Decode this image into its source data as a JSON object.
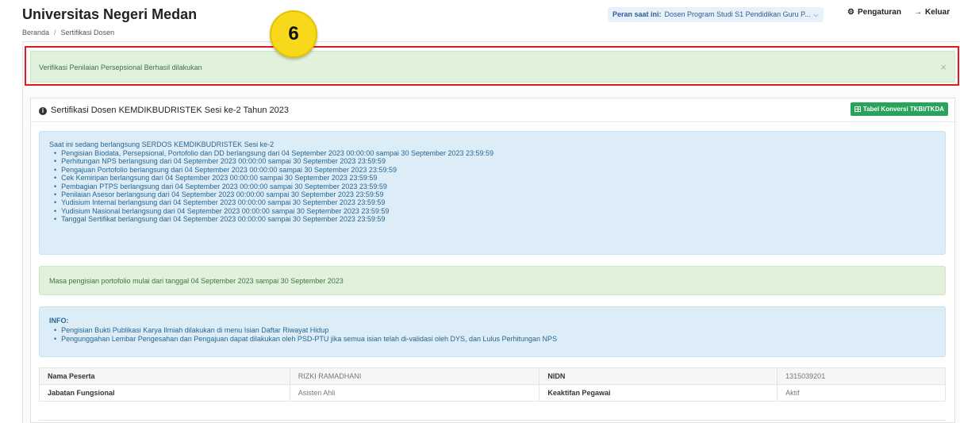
{
  "header": {
    "brand": "Universitas Negeri Medan",
    "breadcrumb": [
      "Beranda",
      "Sertifikasi Dosen"
    ],
    "role_label": "Peran saat ini:",
    "role_value": "Dosen Program Studi S1 Pendidikan Guru P...",
    "settings_label": "Pengaturan",
    "logout_label": "Keluar"
  },
  "step_badge": "6",
  "alert_success": {
    "message": "Verifikasi Penilaian Persepsional Berhasil dilakukan",
    "close": "×"
  },
  "panel": {
    "title": "Sertifikasi Dosen KEMDIKBUDRISTEK Sesi ke-2 Tahun 2023",
    "tabel_button": "Tabel Konversi TKBI/TKDA",
    "serdos_intro": "Saat ini sedang berlangsung SERDOS KEMDIKBUDRISTEK Sesi ke-2",
    "serdos_items": [
      "Pengisian Biodata, Persepsional, Portofolio dan DD berlangsung dari 04 September 2023 00:00:00 sampai 30 September 2023 23:59:59",
      "Perhitungan NPS berlangsung dari 04 September 2023 00:00:00 sampai 30 September 2023 23:59:59",
      "Pengajuan Portofolio berlangsung dari 04 September 2023 00:00:00 sampai 30 September 2023 23:59:59",
      "Cek Kemiripan berlangsung dari 04 September 2023 00:00:00 sampai 30 September 2023 23:59:59",
      "Pembagian PTPS berlangsung dari 04 September 2023 00:00:00 sampai 30 September 2023 23:59:59",
      "Penilaian Asesor berlangsung dari 04 September 2023 00:00:00 sampai 30 September 2023 23:59:59",
      "Yudisium Internal berlangsung dari 04 September 2023 00:00:00 sampai 30 September 2023 23:59:59",
      "Yudisium Nasional berlangsung dari 04 September 2023 00:00:00 sampai 30 September 2023 23:59:59",
      "Tanggal Sertifikat berlangsung dari 04 September 2023 00:00:00 sampai 30 September 2023 23:59:59"
    ],
    "masa_message": "Masa pengisian portofolio mulai dari tanggal 04 September 2023 sampai 30 September 2023",
    "info_head": "INFO:",
    "info_items": [
      "Pengisian Bukti Publikasi Karya Ilmiah dilakukan di menu Isian Daftar Riwayat Hidup",
      "Pengunggahan Lembar Pengesahan dan Pengajuan dapat dilakukan oleh PSD-PTU jika semua isian telah di-validasi oleh DYS, dan Lulus Perhitungan NPS"
    ],
    "peserta": [
      [
        "Nama Peserta",
        "RIZKI RAMADHANI",
        "NIDN",
        "1315039201"
      ],
      [
        "Jabatan Fungsional",
        "Asisten Ahli",
        "Keaktifan Pegawai",
        "Aktif"
      ]
    ]
  }
}
